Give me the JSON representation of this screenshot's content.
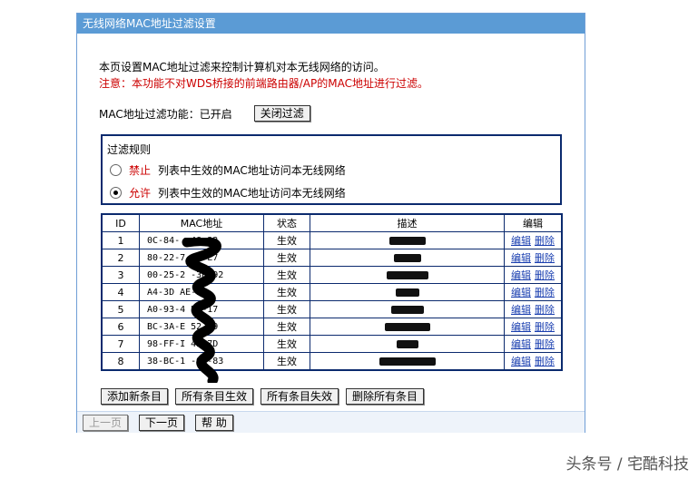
{
  "panel": {
    "title": "无线网络MAC地址过滤设置"
  },
  "intro": {
    "line1": "本页设置MAC地址过滤来控制计算机对本无线网络的访问。",
    "line2": "注意：本功能不对WDS桥接的前端路由器/AP的MAC地址进行过滤。"
  },
  "status": {
    "label": "MAC地址过滤功能：已开启",
    "toggle_button": "关闭过滤"
  },
  "filter_rules": {
    "title": "过滤规则",
    "deny": {
      "keyword": "禁止",
      "text": "列表中生效的MAC地址访问本无线网络",
      "selected": false
    },
    "allow": {
      "keyword": "允许",
      "text": "列表中生效的MAC地址访问本无线网络",
      "selected": true
    }
  },
  "table": {
    "headers": [
      "ID",
      "MAC地址",
      "状态",
      "描述",
      "编辑"
    ],
    "edit_label": "编辑",
    "delete_label": "删除",
    "rows": [
      {
        "id": "1",
        "mac": "0C-84-  -48-33",
        "status": "生效"
      },
      {
        "id": "2",
        "mac": "80-22-7  07-E7",
        "status": "生效"
      },
      {
        "id": "3",
        "mac": "00-25-2  -3D-92",
        "status": "生效"
      },
      {
        "id": "4",
        "mac": "A4-3D  AE-E",
        "status": "生效"
      },
      {
        "id": "5",
        "mac": "A0-93-4  B9-17",
        "status": "生效"
      },
      {
        "id": "6",
        "mac": "BC-3A-E  52-19",
        "status": "生效"
      },
      {
        "id": "7",
        "mac": "98-FF-I  4E-7D",
        "status": "生效"
      },
      {
        "id": "8",
        "mac": "38-BC-1  -96-83",
        "status": "生效"
      }
    ]
  },
  "actions": {
    "add": "添加新条目",
    "enable_all": "所有条目生效",
    "disable_all": "所有条目失效",
    "delete_all": "删除所有条目"
  },
  "nav": {
    "prev": "上一页",
    "next": "下一页",
    "help": "帮 助"
  },
  "watermark": "头条号 / 宅酷科技"
}
